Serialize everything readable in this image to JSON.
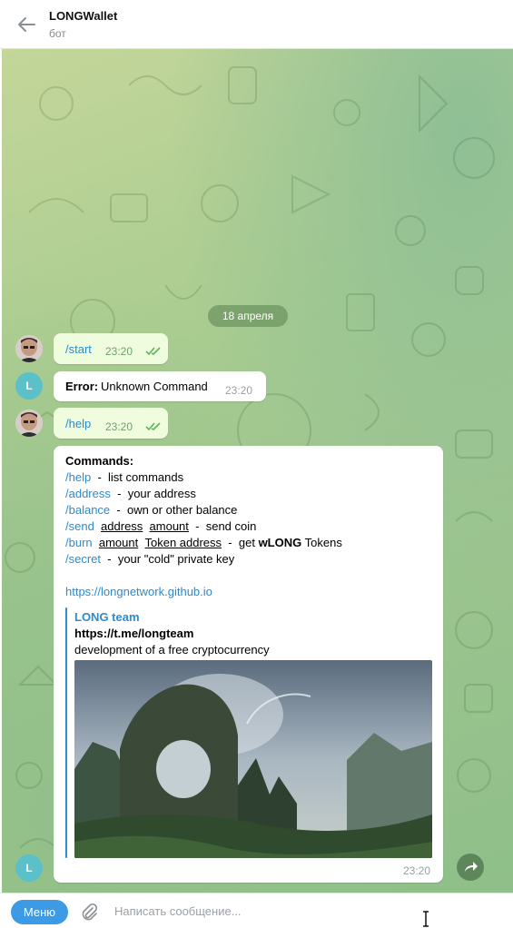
{
  "header": {
    "title": "LONGWallet",
    "subtitle": "бот"
  },
  "date_pill": "18 апреля",
  "avatar_letter": "L",
  "messages": [
    {
      "text": "/start",
      "time": "23:20"
    },
    {
      "label": "Error:",
      "text": "Unknown Command",
      "time": "23:20"
    },
    {
      "text": "/help",
      "time": "23:20"
    }
  ],
  "help": {
    "heading": "Commands:",
    "lines": [
      {
        "cmd": "/help",
        "sep": "-",
        "desc": "list commands"
      },
      {
        "cmd": "/address",
        "sep": "-",
        "desc": "your address"
      },
      {
        "cmd": "/balance",
        "sep": "-",
        "desc": "own or other balance"
      },
      {
        "cmd": "/send",
        "arg1": "address",
        "arg2": "amount",
        "sep": "-",
        "desc": "send coin"
      },
      {
        "cmd": "/burn",
        "arg1": "amount",
        "arg2": "Token address",
        "sep": "-",
        "desc_pre": "get",
        "desc_bold": "wLONG",
        "desc_post": "Tokens"
      },
      {
        "cmd": "/secret",
        "sep": "-",
        "desc": "your \"cold\" private key"
      }
    ],
    "url": "https://longnetwork.github.io",
    "preview": {
      "site": "LONG team",
      "title": "https://t.me/longteam",
      "description": "development of a free cryptocurrency"
    },
    "time": "23:20"
  },
  "composer": {
    "menu": "Меню",
    "placeholder": "Написать сообщение..."
  },
  "colors": {
    "accent": "#2a8bd0",
    "outgoing_bubble": "#effdde",
    "menu_button": "#3d9ae4"
  },
  "icons": [
    "back-arrow-icon",
    "double-check-icon",
    "share-icon",
    "paperclip-icon",
    "text-cursor-icon"
  ]
}
